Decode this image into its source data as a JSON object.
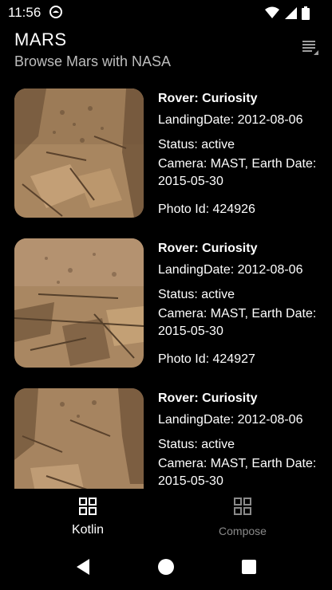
{
  "status_bar": {
    "time": "11:56",
    "icons": [
      "sync-circle-icon",
      "wifi-icon",
      "signal-icon",
      "battery-icon"
    ]
  },
  "header": {
    "title": "MARS",
    "subtitle": "Browse Mars with NASA",
    "menu_icon": "filter-list-icon"
  },
  "photos": [
    {
      "rover": "Rover: Curiosity",
      "landing": "LandingDate: 2012-08-06",
      "status": "Status: active",
      "camera": "Camera: MAST, Earth Date: 2015-05-30",
      "photo_id": "Photo Id: 424926"
    },
    {
      "rover": "Rover: Curiosity",
      "landing": "LandingDate: 2012-08-06",
      "status": "Status: active",
      "camera": "Camera: MAST, Earth Date: 2015-05-30",
      "photo_id": "Photo Id: 424927"
    },
    {
      "rover": "Rover: Curiosity",
      "landing": "LandingDate: 2012-08-06",
      "status": "Status: active",
      "camera": "Camera: MAST, Earth Date: 2015-05-30"
    }
  ],
  "bottom_nav": {
    "items": [
      {
        "label": "Kotlin",
        "icon": "grid-icon",
        "selected": true
      },
      {
        "label": "Compose",
        "icon": "grid-icon",
        "selected": false
      }
    ]
  },
  "system_nav": [
    "back-icon",
    "home-icon",
    "recents-icon"
  ],
  "colors": {
    "background": "#000000",
    "text": "#ffffff",
    "subtitle": "#bdbdbd",
    "inactive": "#8a8a8a",
    "mars_soil": "#b08a62"
  }
}
